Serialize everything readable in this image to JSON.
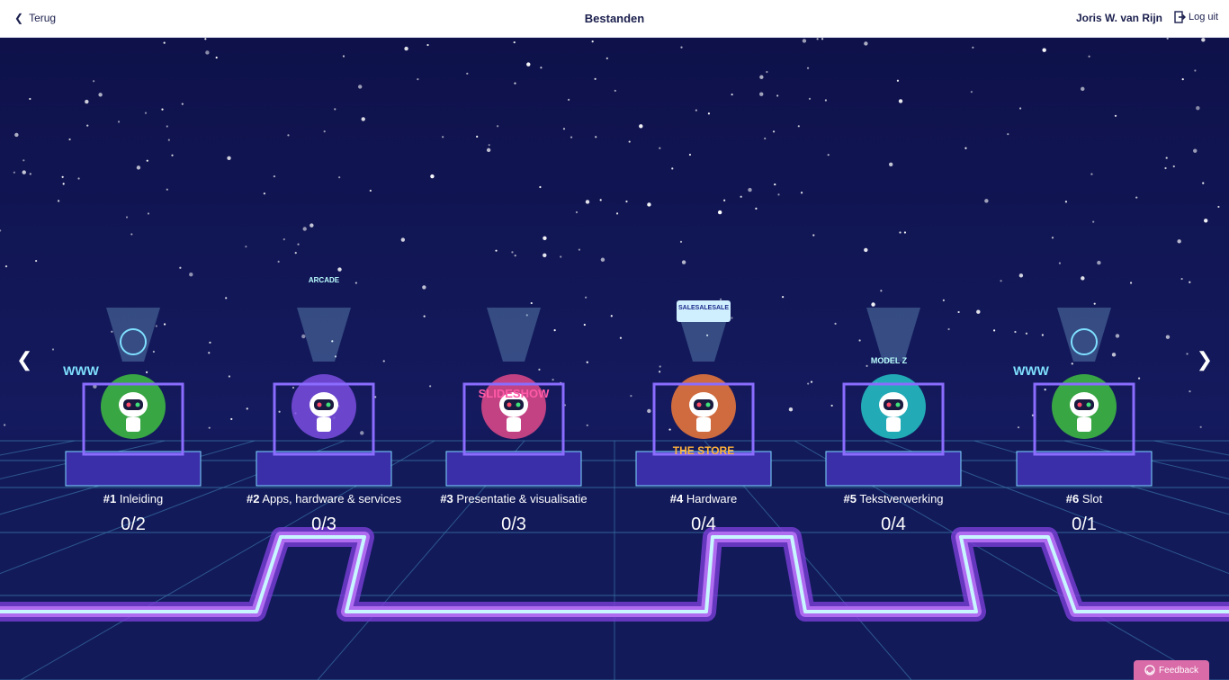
{
  "header": {
    "back_label": "Terug",
    "title": "Bestanden",
    "user_name": "Joris W. van Rijn",
    "logout_label": "Log uit"
  },
  "stations": [
    {
      "number": "#1",
      "name": "Inleiding",
      "score": "0/2",
      "color": "#3fbf3f"
    },
    {
      "number": "#2",
      "name": "Apps, hardware & services",
      "score": "0/3",
      "color": "#7b4ee0"
    },
    {
      "number": "#3",
      "name": "Presentatie & visualisatie",
      "score": "0/3",
      "color": "#e04a8a"
    },
    {
      "number": "#4",
      "name": "Hardware",
      "score": "0/4",
      "color": "#f07a3a"
    },
    {
      "number": "#5",
      "name": "Tekstverwerking",
      "score": "0/4",
      "color": "#25c6c6"
    },
    {
      "number": "#6",
      "name": "Slot",
      "score": "0/1",
      "color": "#3fbf3f"
    }
  ],
  "station_signs": {
    "www": "WWW",
    "arcade": "ARCADE",
    "slideshow": "SLIDESHOW",
    "store": "THE STORE",
    "sale": "SALESALESALE",
    "model": "MODEL Z"
  },
  "nav": {
    "prev_icon": "chevron-left-icon",
    "next_icon": "chevron-right-icon"
  },
  "feedback": {
    "label": "Feedback"
  },
  "colors": {
    "background": "#0e114a",
    "neon_path": "#b06cf0",
    "neon_core": "#c8f6ff"
  }
}
